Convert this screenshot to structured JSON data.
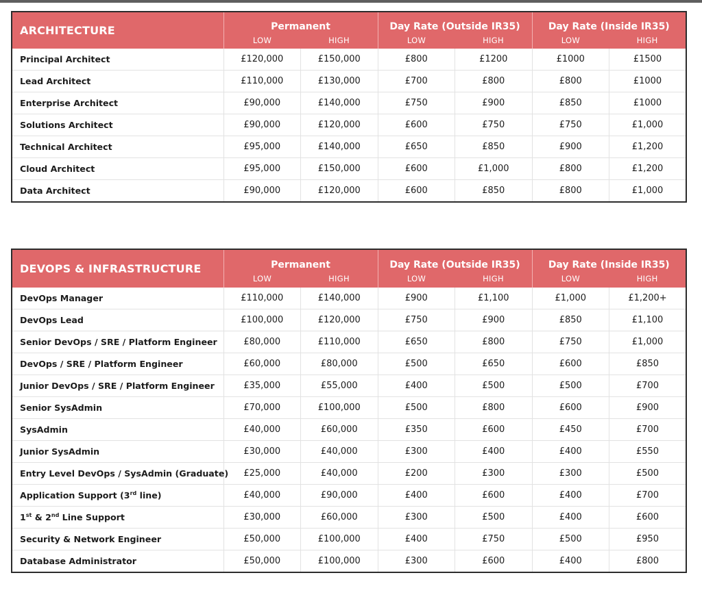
{
  "sections": [
    {
      "title": "ARCHITECTURE",
      "groups": [
        {
          "label": "Permanent",
          "low": "LOW",
          "high": "HIGH"
        },
        {
          "label": "Day Rate (Outside IR35)",
          "low": "LOW",
          "high": "HIGH"
        },
        {
          "label": "Day Rate (Inside IR35)",
          "low": "LOW",
          "high": "HIGH"
        }
      ],
      "rows": [
        {
          "role": "Principal Architect",
          "values": [
            "£120,000",
            "£150,000",
            "£800",
            "£1200",
            "£1000",
            "£1500"
          ]
        },
        {
          "role": "Lead Architect",
          "values": [
            "£110,000",
            "£130,000",
            "£700",
            "£800",
            "£800",
            "£1000"
          ]
        },
        {
          "role": "Enterprise Architect",
          "values": [
            "£90,000",
            "£140,000",
            "£750",
            "£900",
            "£850",
            "£1000"
          ]
        },
        {
          "role": "Solutions Architect",
          "values": [
            "£90,000",
            "£120,000",
            "£600",
            "£750",
            "£750",
            "£1,000"
          ]
        },
        {
          "role": "Technical Architect",
          "values": [
            "£95,000",
            "£140,000",
            "£650",
            "£850",
            "£900",
            "£1,200"
          ]
        },
        {
          "role": "Cloud Architect",
          "values": [
            "£95,000",
            "£150,000",
            "£600",
            "£1,000",
            "£800",
            "£1,200"
          ]
        },
        {
          "role": "Data Architect",
          "values": [
            "£90,000",
            "£120,000",
            "£600",
            "£850",
            "£800",
            "£1,000"
          ]
        }
      ]
    },
    {
      "title": "DEVOPS & INFRASTRUCTURE",
      "groups": [
        {
          "label": "Permanent",
          "low": "LOW",
          "high": "HIGH"
        },
        {
          "label": "Day Rate (Outside IR35)",
          "low": "LOW",
          "high": "HIGH"
        },
        {
          "label": "Day Rate (Inside IR35)",
          "low": "LOW",
          "high": "HIGH"
        }
      ],
      "rows": [
        {
          "role": "DevOps Manager",
          "values": [
            "£110,000",
            "£140,000",
            "£900",
            "£1,100",
            "£1,000",
            "£1,200+"
          ]
        },
        {
          "role": "DevOps Lead",
          "values": [
            "£100,000",
            "£120,000",
            "£750",
            "£900",
            "£850",
            "£1,100"
          ]
        },
        {
          "role": "Senior DevOps / SRE / Platform Engineer",
          "values": [
            "£80,000",
            "£110,000",
            "£650",
            "£800",
            "£750",
            "£1,000"
          ]
        },
        {
          "role": "DevOps / SRE / Platform Engineer",
          "values": [
            "£60,000",
            "£80,000",
            "£500",
            "£650",
            "£600",
            "£850"
          ]
        },
        {
          "role": "Junior DevOps / SRE / Platform Engineer",
          "values": [
            "£35,000",
            "£55,000",
            "£400",
            "£500",
            "£500",
            "£700"
          ]
        },
        {
          "role": "Senior SysAdmin",
          "values": [
            "£70,000",
            "£100,000",
            "£500",
            "£800",
            "£600",
            "£900"
          ]
        },
        {
          "role": "SysAdmin",
          "values": [
            "£40,000",
            "£60,000",
            "£350",
            "£600",
            "£450",
            "£700"
          ]
        },
        {
          "role": "Junior SysAdmin",
          "values": [
            "£30,000",
            "£40,000",
            "£300",
            "£400",
            "£400",
            "£550"
          ]
        },
        {
          "role": "Entry Level DevOps / SysAdmin (Graduate)",
          "values": [
            "£25,000",
            "£40,000",
            "£200",
            "£300",
            "£300",
            "£500"
          ]
        },
        {
          "role": "Application Support (3rd line)",
          "role_main": "Application Support (3",
          "role_sup": "rd",
          "role_tail": " line)",
          "values": [
            "£40,000",
            "£90,000",
            "£400",
            "£600",
            "£400",
            "£700"
          ]
        },
        {
          "role": "1st & 2nd Line Support",
          "role_p1": "1",
          "role_s1": "st",
          "role_p2": " & 2",
          "role_s2": "nd",
          "role_p3": " Line Support",
          "values": [
            "£30,000",
            "£60,000",
            "£300",
            "£500",
            "£400",
            "£600"
          ]
        },
        {
          "role": "Security & Network Engineer",
          "values": [
            "£50,000",
            "£100,000",
            "£400",
            "£750",
            "£500",
            "£950"
          ]
        },
        {
          "role": "Database Administrator",
          "values": [
            "£50,000",
            "£100,000",
            "£300",
            "£600",
            "£400",
            "£800"
          ]
        }
      ]
    }
  ]
}
